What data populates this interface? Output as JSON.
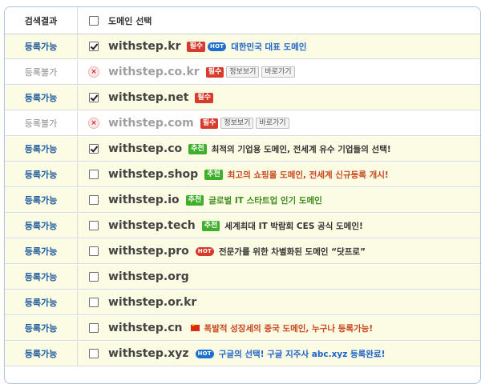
{
  "header": {
    "status_label": "검색결과",
    "domain_label": "도메인 선택"
  },
  "rows": [
    {
      "status": "등록가능",
      "available": true,
      "checked": true,
      "domain": "withstep.kr",
      "extras": [
        {
          "kind": "badge",
          "color": "red",
          "text": "필수"
        },
        {
          "kind": "hot",
          "color": "blue",
          "text": "HOT"
        },
        {
          "kind": "desc",
          "color": "blue",
          "text": "대한민국 대표 도메인"
        }
      ]
    },
    {
      "status": "등록불가",
      "available": false,
      "checked": false,
      "domain": "withstep.co.kr",
      "extras": [
        {
          "kind": "badge",
          "color": "red",
          "text": "필수"
        },
        {
          "kind": "button",
          "text": "정보보기"
        },
        {
          "kind": "button",
          "text": "바로가기"
        }
      ]
    },
    {
      "status": "등록가능",
      "available": true,
      "checked": true,
      "domain": "withstep.net",
      "extras": [
        {
          "kind": "badge",
          "color": "red",
          "text": "필수"
        }
      ]
    },
    {
      "status": "등록불가",
      "available": false,
      "checked": false,
      "domain": "withstep.com",
      "extras": [
        {
          "kind": "badge",
          "color": "red",
          "text": "필수"
        },
        {
          "kind": "button",
          "text": "정보보기"
        },
        {
          "kind": "button",
          "text": "바로가기"
        }
      ]
    },
    {
      "status": "등록가능",
      "available": true,
      "checked": true,
      "domain": "withstep.co",
      "extras": [
        {
          "kind": "badge",
          "color": "green",
          "text": "추천"
        },
        {
          "kind": "desc",
          "color": "dark",
          "text": "최적의 기업용 도메인, 전세계 유수 기업들의 선택!"
        }
      ]
    },
    {
      "status": "등록가능",
      "available": true,
      "checked": false,
      "domain": "withstep.shop",
      "extras": [
        {
          "kind": "badge",
          "color": "green",
          "text": "추천"
        },
        {
          "kind": "desc",
          "color": "orange",
          "text": "최고의 쇼핑몰 도메인, 전세계 신규등록 개시!"
        }
      ]
    },
    {
      "status": "등록가능",
      "available": true,
      "checked": false,
      "domain": "withstep.io",
      "extras": [
        {
          "kind": "badge",
          "color": "green",
          "text": "추천"
        },
        {
          "kind": "desc",
          "color": "green",
          "text": "글로벌 IT 스타트업 인기 도메인"
        }
      ]
    },
    {
      "status": "등록가능",
      "available": true,
      "checked": false,
      "domain": "withstep.tech",
      "extras": [
        {
          "kind": "badge",
          "color": "green",
          "text": "추천"
        },
        {
          "kind": "desc",
          "color": "dark",
          "text": "세계최대 IT 박람회 CES 공식 도메인!"
        }
      ]
    },
    {
      "status": "등록가능",
      "available": true,
      "checked": false,
      "domain": "withstep.pro",
      "extras": [
        {
          "kind": "hot",
          "color": "red",
          "text": "HOT"
        },
        {
          "kind": "desc",
          "color": "dark",
          "text": "전문가를 위한 차별화된 도메인 “닷프로”"
        }
      ]
    },
    {
      "status": "등록가능",
      "available": true,
      "checked": false,
      "domain": "withstep.org",
      "extras": []
    },
    {
      "status": "등록가능",
      "available": true,
      "checked": false,
      "domain": "withstep.or.kr",
      "extras": []
    },
    {
      "status": "등록가능",
      "available": true,
      "checked": false,
      "domain": "withstep.cn",
      "extras": [
        {
          "kind": "flag"
        },
        {
          "kind": "desc",
          "color": "orange",
          "text": "폭발적 성장세의 중국 도메인, 누구나 등록가능!"
        }
      ]
    },
    {
      "status": "등록가능",
      "available": true,
      "checked": false,
      "domain": "withstep.xyz",
      "extras": [
        {
          "kind": "hot",
          "color": "blue",
          "text": "HOT"
        },
        {
          "kind": "desc",
          "color": "blue",
          "text": "구글의 선택! 구글 지주사 abc.xyz 등록완료!"
        }
      ]
    }
  ]
}
